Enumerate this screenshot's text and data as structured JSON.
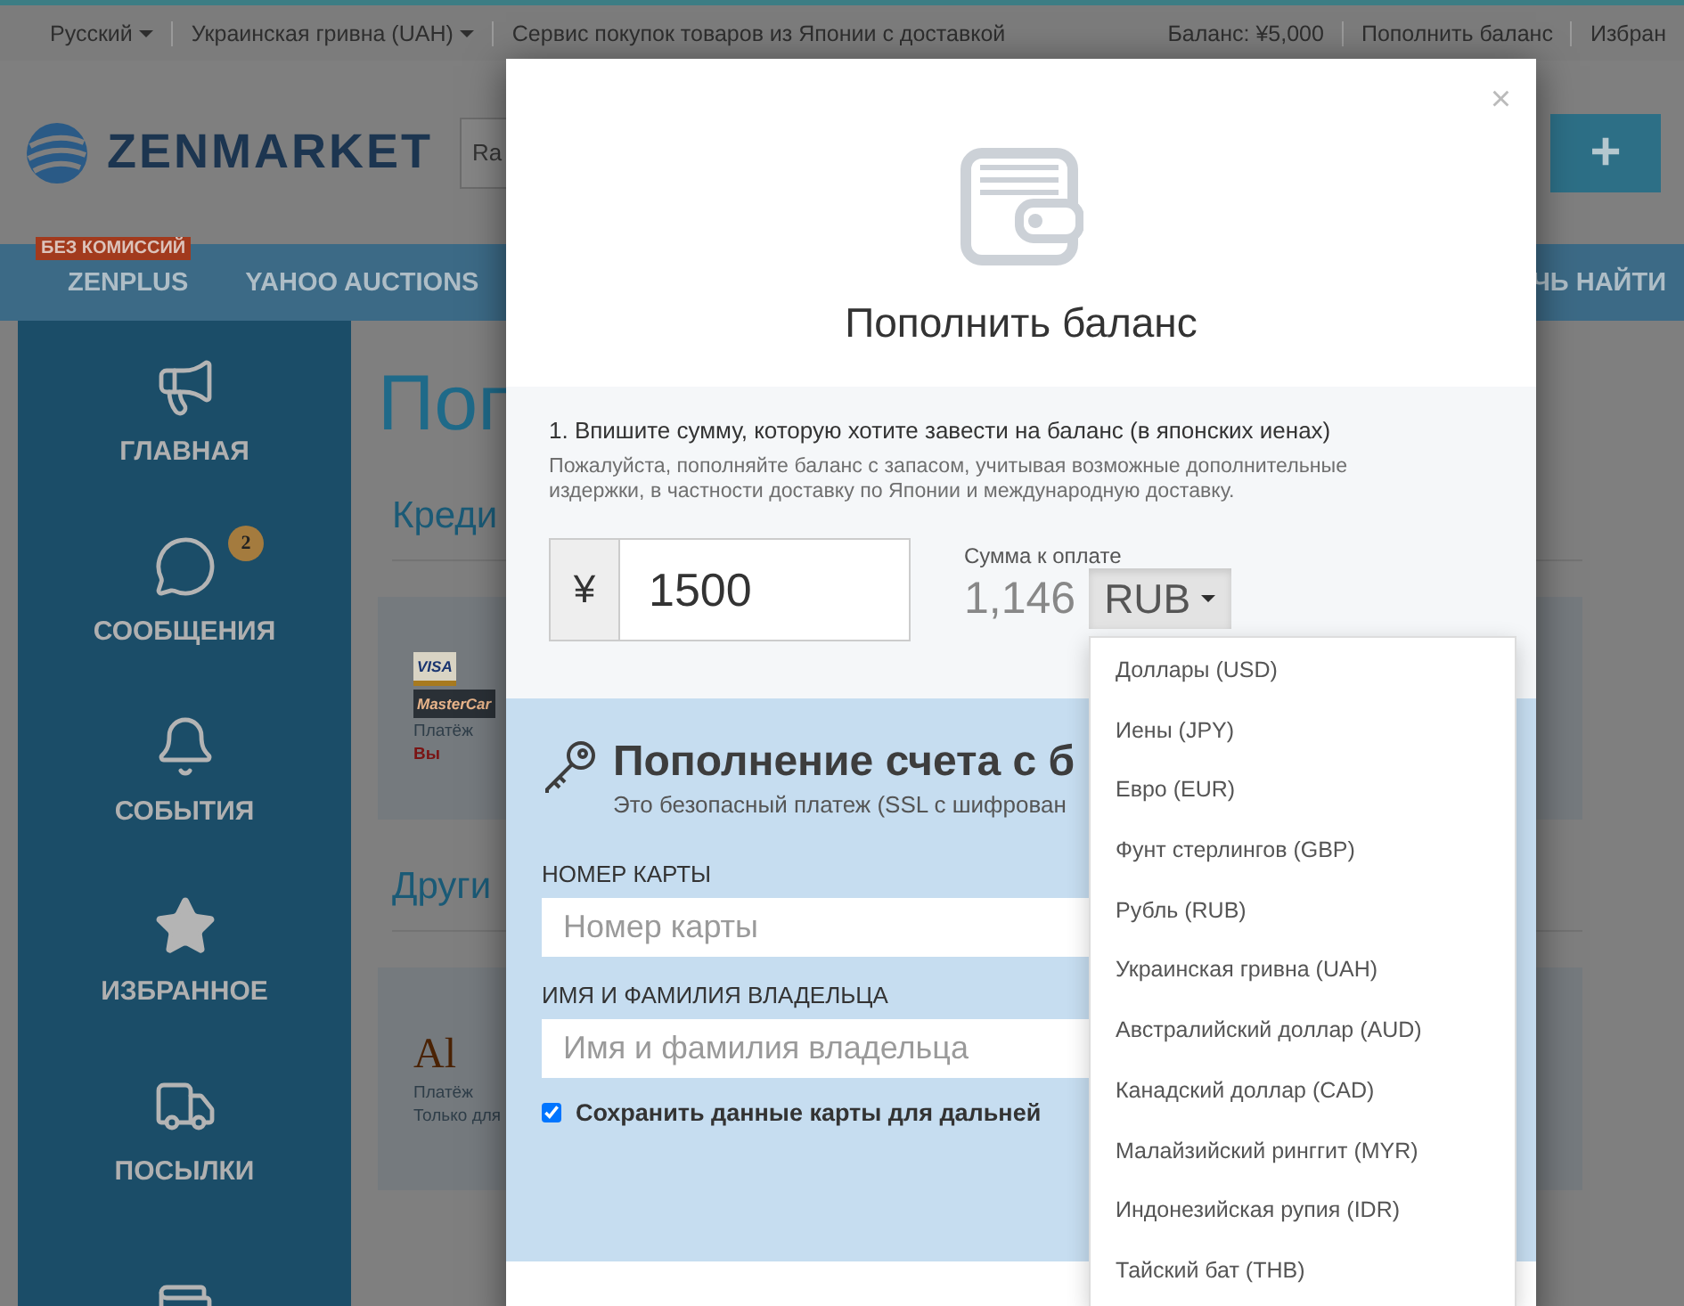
{
  "top_bar": {
    "language": "Русский",
    "currency": "Украинская гривна (UAH)",
    "tagline": "Сервис покупок товаров из Японии с доставкой",
    "balance": "Баланс: ¥5,000",
    "links": [
      "Пополнить баланс",
      "Избран"
    ]
  },
  "header": {
    "logo": "ZENMARKET",
    "search": {
      "value": "Ra"
    },
    "add_button": "+"
  },
  "nav": {
    "promo_badge": "БЕЗ КОМИССИЙ",
    "items": [
      "ZENPLUS",
      "YAHOO AUCTIONS"
    ],
    "right_item": "ЧЬ НАЙТИ"
  },
  "sidebar": {
    "items": [
      {
        "label": "ГЛАВНАЯ"
      },
      {
        "label": "СООБЩЕНИЯ",
        "badge": "2"
      },
      {
        "label": "СОБЫТИЯ"
      },
      {
        "label": "ИЗБРАННОЕ"
      },
      {
        "label": "ПОСЫЛКИ"
      }
    ]
  },
  "page": {
    "title": "Поп",
    "sections": [
      {
        "heading": "Креди",
        "card": {
          "logos": [
            "VISA",
            "MasterCar"
          ],
          "lines": [
            {
              "text": "Платёж",
              "kind": "normal"
            },
            {
              "text": "Вы",
              "kind": "warning"
            }
          ]
        }
      },
      {
        "heading": "Други",
        "card": {
          "logos": [
            "Al"
          ],
          "lines": [
            {
              "text": "Платёж",
              "kind": "normal"
            },
            {
              "text": "Только для",
              "kind": "normal"
            }
          ]
        }
      }
    ]
  },
  "modal": {
    "close": "×",
    "title": "Пополнить баланс",
    "amount_section": {
      "instruction": "1. Впишите сумму, которую хотите завести на баланс (в японских иенах)",
      "hint": "Пожалуйста, пополняйте баланс с запасом, учитывая возможные дополнительные издержки, в частности доставку по Японии и международную доставку.",
      "currency_symbol": "¥",
      "amount": "1500",
      "total_label": "Сумма к оплате",
      "total": "1,146",
      "currency": "RUB",
      "currency_menu": {
        "open": true,
        "options": [
          "Доллары (USD)",
          "Иены (JPY)",
          "Евро (EUR)",
          "Фунт стерлингов (GBP)",
          "Рубль (RUB)",
          "Украинская гривна (UAH)",
          "Австралийский доллар (AUD)",
          "Канадский доллар (CAD)",
          "Малайзийский ринггит (MYR)",
          "Индонезийская рупия (IDR)",
          "Тайский бат (THB)"
        ]
      }
    },
    "card_section": {
      "title": "Пополнение счета с б",
      "subtitle": "Это безопасный платеж (SSL с шифрован",
      "fields": [
        {
          "label": "НОМЕР КАРТЫ",
          "placeholder": "Номер карты"
        },
        {
          "label": "ИМЯ И ФАМИЛИЯ ВЛАДЕЛЬЦА",
          "placeholder": "Имя и фамилия владельца"
        }
      ],
      "save_card": {
        "label": "Сохранить данные карты для дальней",
        "checked": true
      }
    }
  }
}
